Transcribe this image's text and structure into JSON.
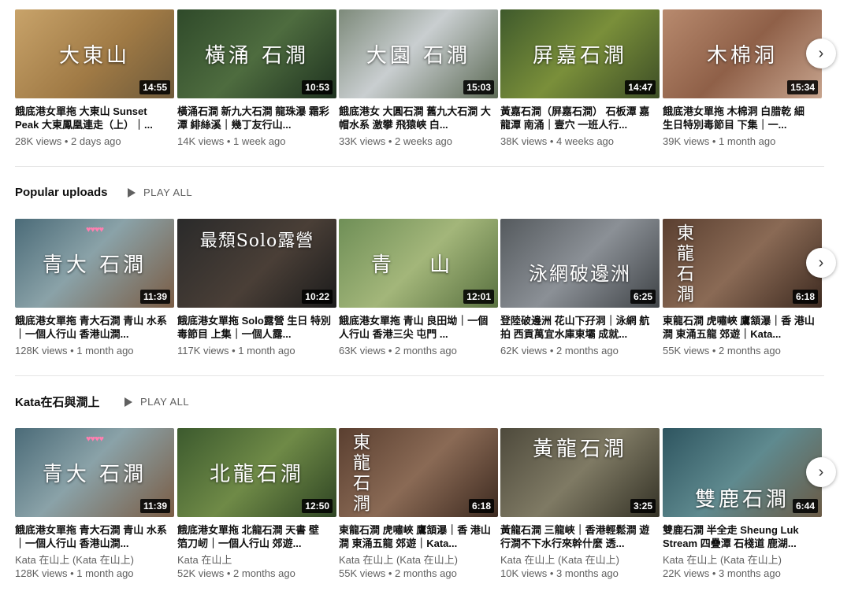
{
  "rows": [
    {
      "videos": [
        {
          "thumb_text": "大東山",
          "duration": "14:55",
          "title": "餓底港女單拖 大東山 Sunset Peak 大東鳳凰連走（上）｜...",
          "meta": "28K views • 2 days ago",
          "bg": "linear-gradient(135deg,#c8a36a,#a07a45 55%,#6e5a3a)"
        },
        {
          "thumb_text": "橫涌 石澗",
          "duration": "10:53",
          "title": "橫涌石澗 新九大石澗 龍珠瀑 霜彩潭 緋絲溪｜幾丁友行山...",
          "meta": "14K views • 1 week ago",
          "bg": "linear-gradient(135deg,#2f4a2a,#4e6c3f 50%,#1f3320)"
        },
        {
          "thumb_text": "大園 石澗",
          "duration": "15:03",
          "title": "餓底港女 大圓石澗 舊九大石澗 大帽水系 激攀 飛猿峽 白...",
          "meta": "33K views • 2 weeks ago",
          "bg": "linear-gradient(135deg,#7d8a7a,#c9ced0 45%,#5c6a55)"
        },
        {
          "thumb_text": "屏嘉石澗",
          "duration": "14:47",
          "title": "黃嘉石澗（屏嘉石澗） 石板潭 嘉龍潭 南涌｜壹穴 一班人行...",
          "meta": "38K views • 4 weeks ago",
          "bg": "linear-gradient(135deg,#3f5a2c,#7a8f3a 50%,#3d4e26)"
        },
        {
          "thumb_text": "木棉洞",
          "duration": "15:34",
          "title": "餓底港女單拖 木棉洞 白腊乾 細 生日特別毒節目 下集｜一...",
          "meta": "39K views • 1 month ago",
          "bg": "linear-gradient(135deg,#b88a6e,#8f6048 50%,#c7a48e)"
        }
      ]
    },
    {
      "header": {
        "title": "Popular uploads",
        "play_all": "PLAY ALL"
      },
      "videos": [
        {
          "thumb_text": "青大 石澗",
          "duration": "11:39",
          "title": "餓底港女單拖 青大石澗 青山 水系｜一個人行山 香港山澗...",
          "meta": "128K views • 1 month ago",
          "bg": "linear-gradient(135deg,#4b6b78,#8aa2a8 45%,#7a5c44)"
        },
        {
          "thumb_text": "最頹Solo露營",
          "duration": "10:22",
          "title": "餓底港女單拖 Solo露營 生日 特別毒節目 上集｜一個人露...",
          "meta": "117K views • 1 month ago",
          "bg": "linear-gradient(135deg,#2a2a2a,#4a3f37 55%,#1b1b1b)"
        },
        {
          "thumb_text": "青 山",
          "duration": "12:01",
          "title": "餓底港女單拖 青山 良田坳｜一個人行山 香港三尖 屯門 ...",
          "meta": "63K views • 2 months ago",
          "bg": "linear-gradient(135deg,#6f8f57,#a3b67a 50%,#58703f)"
        },
        {
          "thumb_text": "泳網破邊洲",
          "duration": "6:25",
          "title": "登陸破邊洲 花山下孖洞｜泳網 航拍 西貢萬宜水庫東壩 成就...",
          "meta": "62K views • 2 months ago",
          "bg": "linear-gradient(135deg,#555a5e,#8b9096 50%,#3f4347)"
        },
        {
          "thumb_text": "東龍石澗",
          "duration": "6:18",
          "title": "東龍石澗 虎嘯峽 鷹頷瀑｜香 港山澗 東涌五龍 郊遊｜Kata...",
          "meta": "55K views • 2 months ago",
          "bg": "linear-gradient(135deg,#5a3f30,#8a6a55 50%,#3d2a20)"
        }
      ]
    },
    {
      "header": {
        "title": "Kata在石與澗上",
        "play_all": "PLAY ALL"
      },
      "videos": [
        {
          "thumb_text": "青大 石澗",
          "duration": "11:39",
          "title": "餓底港女單拖 青大石澗 青山 水系｜一個人行山 香港山澗...",
          "channel": "Kata 在山上 (Kata 在山上)",
          "meta": "128K views • 1 month ago",
          "bg": "linear-gradient(135deg,#4b6b78,#8aa2a8 45%,#7a5c44)"
        },
        {
          "thumb_text": "北龍石澗",
          "duration": "12:50",
          "title": "餓底港女單拖 北龍石澗 天書 壁 箔刀屻｜一個人行山 郊遊...",
          "channel": "Kata 在山上",
          "meta": "52K views • 2 months ago",
          "bg": "linear-gradient(135deg,#3c5a2e,#6f8a47 50%,#2e4423)"
        },
        {
          "thumb_text": "東龍石澗",
          "duration": "6:18",
          "title": "東龍石澗 虎嘯峽 鷹頷瀑｜香 港山澗 東涌五龍 郊遊｜Kata...",
          "channel": "Kata 在山上 (Kata 在山上)",
          "meta": "55K views • 2 months ago",
          "bg": "linear-gradient(135deg,#5a3f30,#8a6a55 50%,#3d2a20)"
        },
        {
          "thumb_text": "黃龍石澗",
          "duration": "3:25",
          "title": "黃龍石澗 三龍峽｜香港輕鬆澗 遊 行澗不下水行來幹什麼 透...",
          "channel": "Kata 在山上 (Kata 在山上)",
          "meta": "10K views • 3 months ago",
          "bg": "linear-gradient(135deg,#4e4a3c,#7f7a64 50%,#343226)"
        },
        {
          "thumb_text": "雙鹿石澗",
          "duration": "6:44",
          "title": "雙鹿石澗 半全走 Sheung Luk Stream 四疊潭 石棧道 鹿湖...",
          "channel": "Kata 在山上 (Kata 在山上)",
          "meta": "22K views • 3 months ago",
          "bg": "linear-gradient(135deg,#2e5560,#5f8a8f 50%,#6a5a45)"
        }
      ]
    }
  ],
  "icons": {
    "next": "chevron-right-icon",
    "play": "play-icon"
  }
}
